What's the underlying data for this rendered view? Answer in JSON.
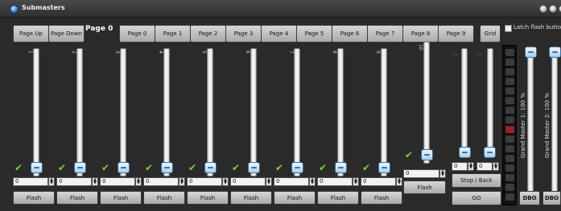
{
  "window": {
    "title": "Submasters"
  },
  "toolbar": {
    "page_up": "Page Up",
    "page_down": "Page Down",
    "current_page": "Page 0",
    "pages": [
      "Page 0",
      "Page 1",
      "Page 2",
      "Page 3",
      "Page 4",
      "Page 5",
      "Page 6",
      "Page 7",
      "Page 8",
      "Page 9"
    ],
    "grid": "Grid",
    "latch_label": "Latch flash buttons"
  },
  "channels": [
    {
      "number": "1",
      "value": "0",
      "flash": "Flash",
      "level": 0
    },
    {
      "number": "2",
      "value": "0",
      "flash": "Flash",
      "level": 0
    },
    {
      "number": "3",
      "value": "0",
      "flash": "Flash",
      "level": 0
    },
    {
      "number": "4",
      "value": "0",
      "flash": "Flash",
      "level": 0
    },
    {
      "number": "5",
      "value": "0",
      "flash": "Flash",
      "level": 0
    },
    {
      "number": "6",
      "value": "0",
      "flash": "Flash",
      "level": 0
    },
    {
      "number": "7",
      "value": "0",
      "flash": "Flash",
      "level": 0
    },
    {
      "number": "8",
      "value": "0",
      "flash": "Flash",
      "level": 0
    },
    {
      "number": "9",
      "value": "0",
      "flash": "Flash",
      "level": 0
    },
    {
      "number": "10",
      "value": "0",
      "flash": "Flash",
      "level": 0
    }
  ],
  "sequence": {
    "fader_a_value": "0",
    "fader_b_value": "0",
    "stop_back": "Stop / Back",
    "go": "GO"
  },
  "grand_masters": [
    {
      "label": "Grand Master 1: 100 %",
      "dbo": "DBO"
    },
    {
      "label": "Grand Master 2: 100 %",
      "dbo": "DBO"
    }
  ],
  "colors": {
    "accent_check": "#7ecf3f",
    "thumb": "#a9cfee"
  }
}
